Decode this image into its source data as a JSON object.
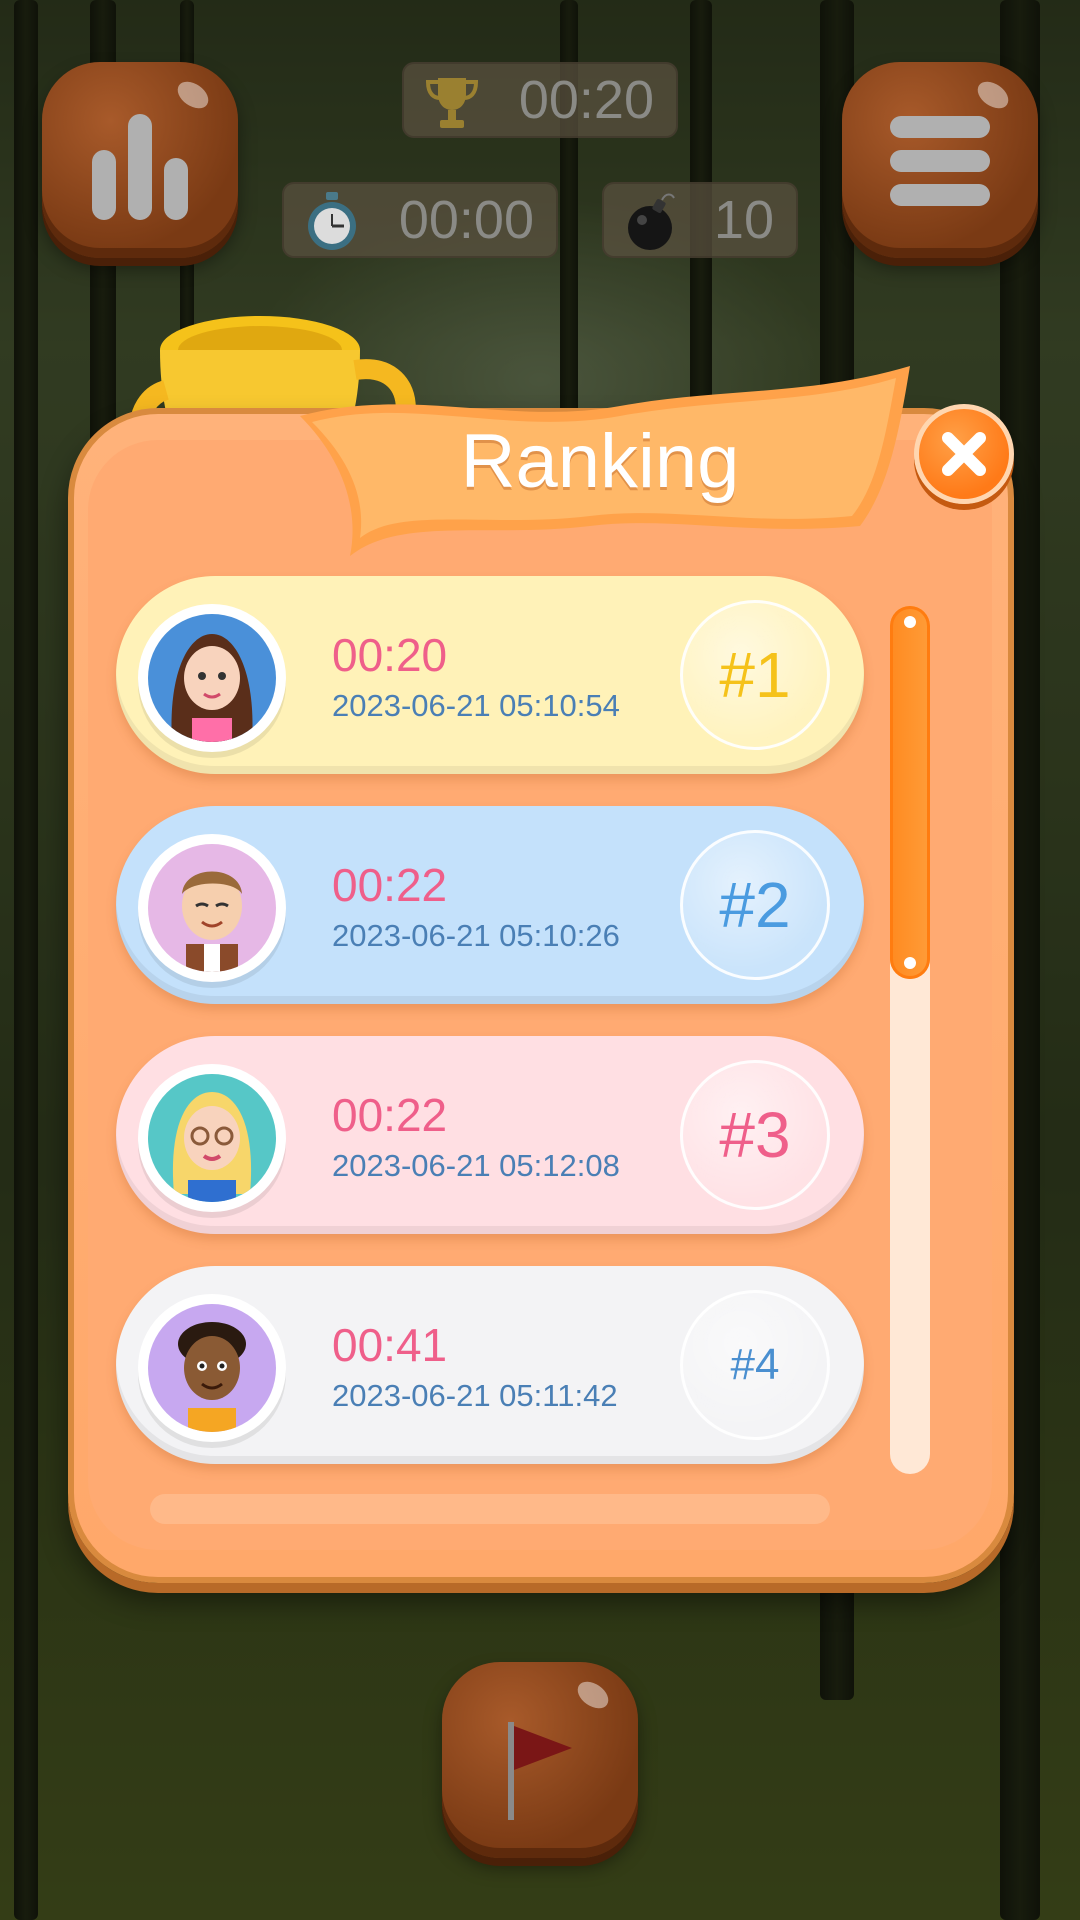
{
  "hud": {
    "best_time": "00:20",
    "elapsed_time": "00:00",
    "mines": "10"
  },
  "dialog": {
    "title": "Ranking"
  },
  "rankings": [
    {
      "time": "00:20",
      "date": "2023-06-21 05:10:54",
      "rank": "#1",
      "row_color": "#fff2b8",
      "rank_color": "#f5c21a"
    },
    {
      "time": "00:22",
      "date": "2023-06-21 05:10:26",
      "rank": "#2",
      "row_color": "#c4e1fb",
      "rank_color": "#4a9be0"
    },
    {
      "time": "00:22",
      "date": "2023-06-21 05:12:08",
      "rank": "#3",
      "row_color": "#ffdfe3",
      "rank_color": "#ef5f8a"
    },
    {
      "time": "00:41",
      "date": "2023-06-21 05:11:42",
      "rank": "#4",
      "row_color": "#f3f3f5",
      "rank_color": "#4a8fd0"
    }
  ],
  "scroll": {
    "visible_fraction": 0.43
  },
  "icons": {
    "stats": "stats-icon",
    "menu": "menu-icon",
    "trophy": "trophy-icon",
    "stopwatch": "stopwatch-icon",
    "bomb": "bomb-icon",
    "close": "close-icon",
    "flag": "flag-icon"
  }
}
